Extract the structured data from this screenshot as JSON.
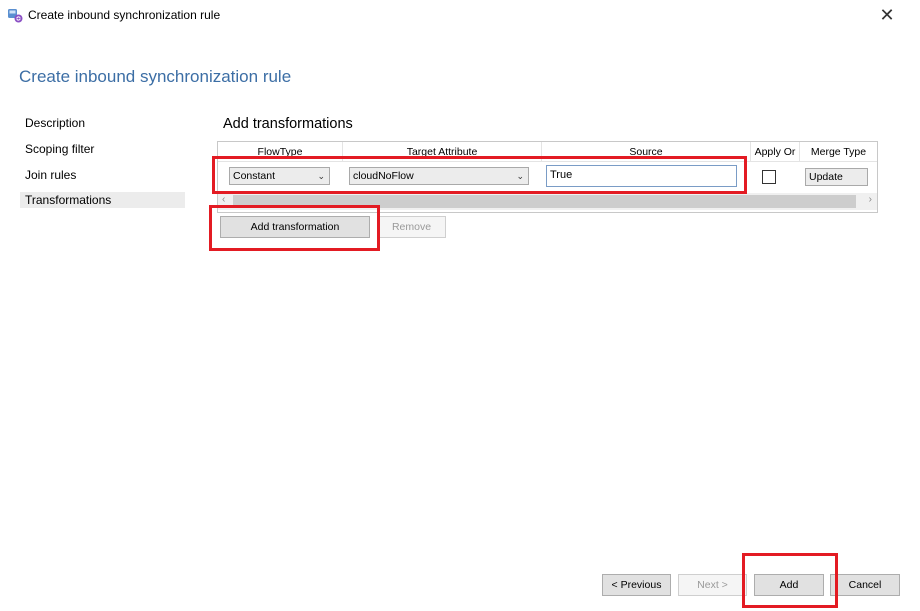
{
  "window": {
    "title": "Create inbound synchronization rule",
    "close_icon": "close-icon",
    "app_icon": "sync-service-icon"
  },
  "page_title": "Create inbound synchronization rule",
  "nav": {
    "items": [
      {
        "label": "Description"
      },
      {
        "label": "Scoping filter"
      },
      {
        "label": "Join rules"
      },
      {
        "label": "Transformations",
        "selected": true
      }
    ]
  },
  "section_title": "Add transformations",
  "grid": {
    "columns": [
      "FlowType",
      "Target Attribute",
      "Source",
      "Apply Or",
      "Merge Type"
    ],
    "rows": [
      {
        "flow_type": "Constant",
        "target_attribute": "cloudNoFlow",
        "source": "True",
        "apply_once": false,
        "merge_type": "Update"
      }
    ]
  },
  "actions": {
    "add_transformation": "Add transformation",
    "remove": "Remove"
  },
  "footer": {
    "previous": "< Previous",
    "next": "Next >",
    "add": "Add",
    "cancel": "Cancel"
  },
  "colors": {
    "title_blue": "#3c6ea5",
    "highlight_red": "#e31b23"
  }
}
